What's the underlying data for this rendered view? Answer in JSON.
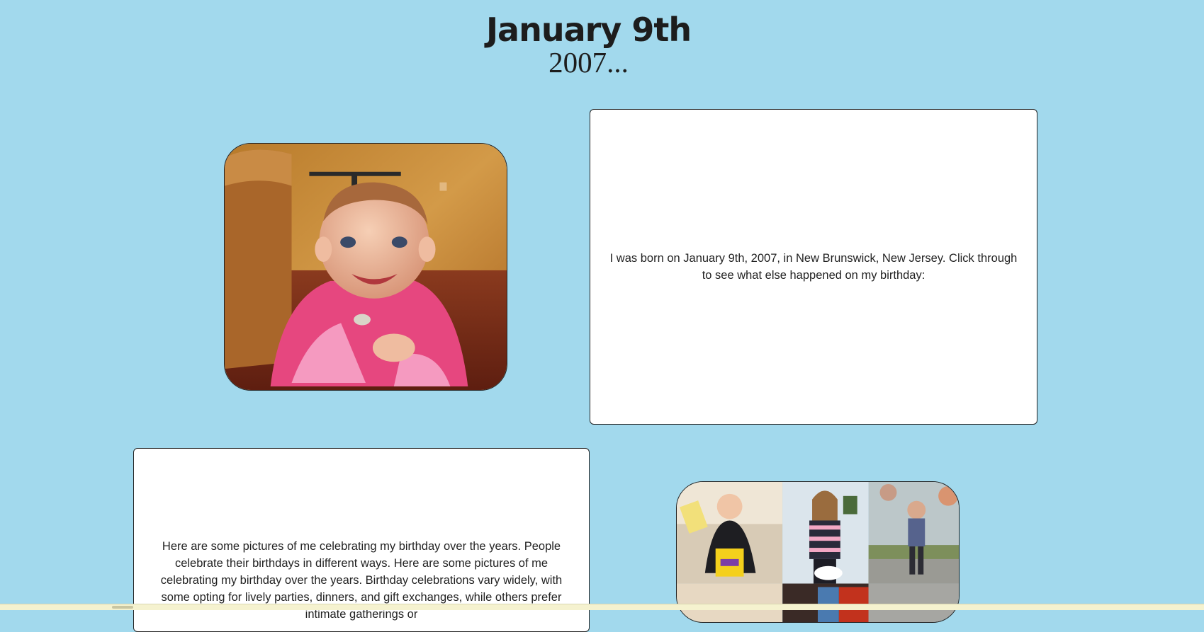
{
  "header": {
    "title": "January 9th",
    "year": "2007..."
  },
  "intro": {
    "text": "I was born on January 9th, 2007, in New Brunswick, New Jersey. Click through to see what else happened on my birthday:"
  },
  "birthdays": {
    "text": "Here are some pictures of me celebrating my birthday over the years. People celebrate their birthdays in different ways. Here are some pictures of me celebrating my birthday over the years. Birthday celebrations vary widely, with some opting for lively parties, dinners, and gift exchanges, while others prefer intimate gatherings or"
  },
  "colors": {
    "background": "#a2d9ed",
    "card": "#ffffff",
    "text": "#222222"
  }
}
